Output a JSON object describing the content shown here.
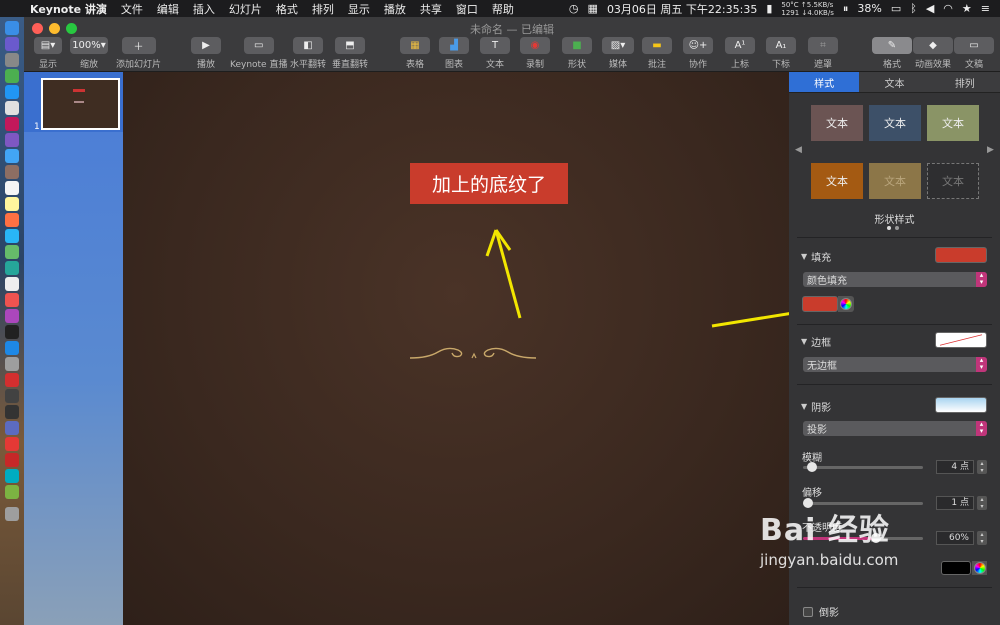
{
  "menubar": {
    "app": "Keynote 讲演",
    "items": [
      "文件",
      "编辑",
      "插入",
      "幻灯片",
      "格式",
      "排列",
      "显示",
      "播放",
      "共享",
      "窗口",
      "帮助"
    ],
    "date_time": "03月06日 周五 下午22:35:35",
    "temp": "50°C",
    "rpm": "1291",
    "net_up": "↑5.5KB/s",
    "net_down": "↓4.0KB/s",
    "battery": "38%"
  },
  "window": {
    "title": "未命名",
    "edited": "— 已编辑"
  },
  "toolbar": {
    "view": "显示",
    "zoom_value": "100%",
    "zoom": "缩放",
    "add_slide": "添加幻灯片",
    "play": "播放",
    "keynote_live": "Keynote 直播",
    "flip_h": "水平翻转",
    "flip_v": "垂直翻转",
    "table": "表格",
    "chart": "图表",
    "text": "文本",
    "record": "录制",
    "shape": "形状",
    "media": "媒体",
    "comment": "批注",
    "collaborate": "协作",
    "superscript": "上标",
    "subscript": "下标",
    "mask": "遮罩",
    "format": "格式",
    "animate": "动画效果",
    "document": "文稿"
  },
  "navigator": {
    "slide_number": "1"
  },
  "slide": {
    "text": "加上的底纹了"
  },
  "inspector": {
    "tabs": [
      "样式",
      "文本",
      "排列"
    ],
    "swatch_text": "文本",
    "shape_styles": "形状样式",
    "fill": "填充",
    "fill_type": "颜色填充",
    "border": "边框",
    "border_type": "无边框",
    "shadow": "阴影",
    "shadow_type": "投影",
    "blur": "模糊",
    "blur_value": "4 点",
    "offset": "偏移",
    "offset_value": "1 点",
    "opacity": "不透明度",
    "opacity_value": "60%",
    "reflection": "倒影"
  },
  "colors": {
    "fill": "#c93c2c",
    "accent": "#2f6fd6"
  },
  "watermark": {
    "big": "Bai 经验",
    "small": "jingyan.baidu.com"
  }
}
